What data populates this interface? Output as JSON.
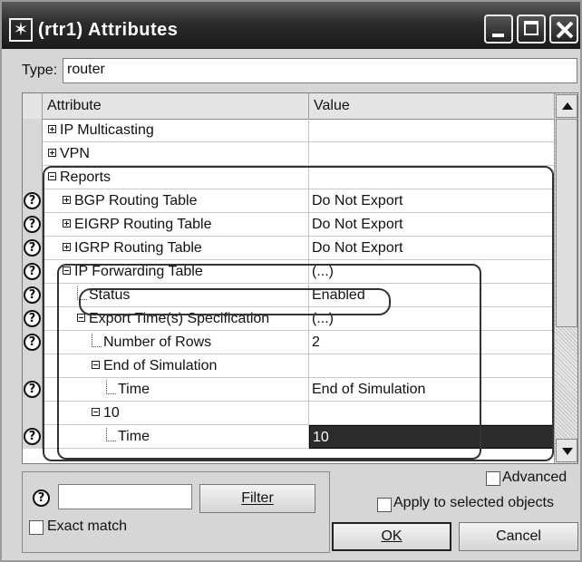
{
  "window": {
    "title": "(rtr1) Attributes",
    "icon": "star-icon"
  },
  "type_row": {
    "label": "Type:",
    "value": "router"
  },
  "table": {
    "col_attribute": "Attribute",
    "col_value": "Value",
    "rows": [
      {
        "attr": "IP Multicasting",
        "value": "",
        "help": false,
        "toggle": "plus",
        "indent": 0
      },
      {
        "attr": "VPN",
        "value": "",
        "help": false,
        "toggle": "plus",
        "indent": 0
      },
      {
        "attr": "Reports",
        "value": "",
        "help": false,
        "toggle": "minus",
        "indent": 0
      },
      {
        "attr": "BGP Routing Table",
        "value": "Do Not Export",
        "help": true,
        "toggle": "plus",
        "indent": 1
      },
      {
        "attr": "EIGRP Routing Table",
        "value": "Do Not Export",
        "help": true,
        "toggle": "plus",
        "indent": 1
      },
      {
        "attr": "IGRP Routing Table",
        "value": "Do Not Export",
        "help": true,
        "toggle": "plus",
        "indent": 1
      },
      {
        "attr": "IP Forwarding Table",
        "value": "(...)",
        "help": true,
        "toggle": "minus",
        "indent": 1
      },
      {
        "attr": "Status",
        "value": "Enabled",
        "help": true,
        "toggle": "leaf",
        "indent": 2
      },
      {
        "attr": "Export Time(s) Specification",
        "value": "(...)",
        "help": true,
        "toggle": "minus",
        "indent": 2
      },
      {
        "attr": "Number of Rows",
        "value": "2",
        "help": true,
        "toggle": "leaf",
        "indent": 3
      },
      {
        "attr": "End of Simulation",
        "value": "",
        "help": false,
        "toggle": "minus",
        "indent": 3
      },
      {
        "attr": "Time",
        "value": "End of Simulation",
        "help": true,
        "toggle": "leaf",
        "indent": 4
      },
      {
        "attr": "10",
        "value": "",
        "help": false,
        "toggle": "minus",
        "indent": 3
      },
      {
        "attr": "Time",
        "value": "10",
        "help": true,
        "toggle": "leaf",
        "indent": 4,
        "selected": true
      }
    ]
  },
  "bottom": {
    "filter_label": "Filter",
    "filter_value": "",
    "exact_match_label": "Exact match",
    "advanced_label": "Advanced",
    "apply_label": "Apply to selected objects",
    "ok_label": "OK",
    "cancel_label": "Cancel"
  }
}
